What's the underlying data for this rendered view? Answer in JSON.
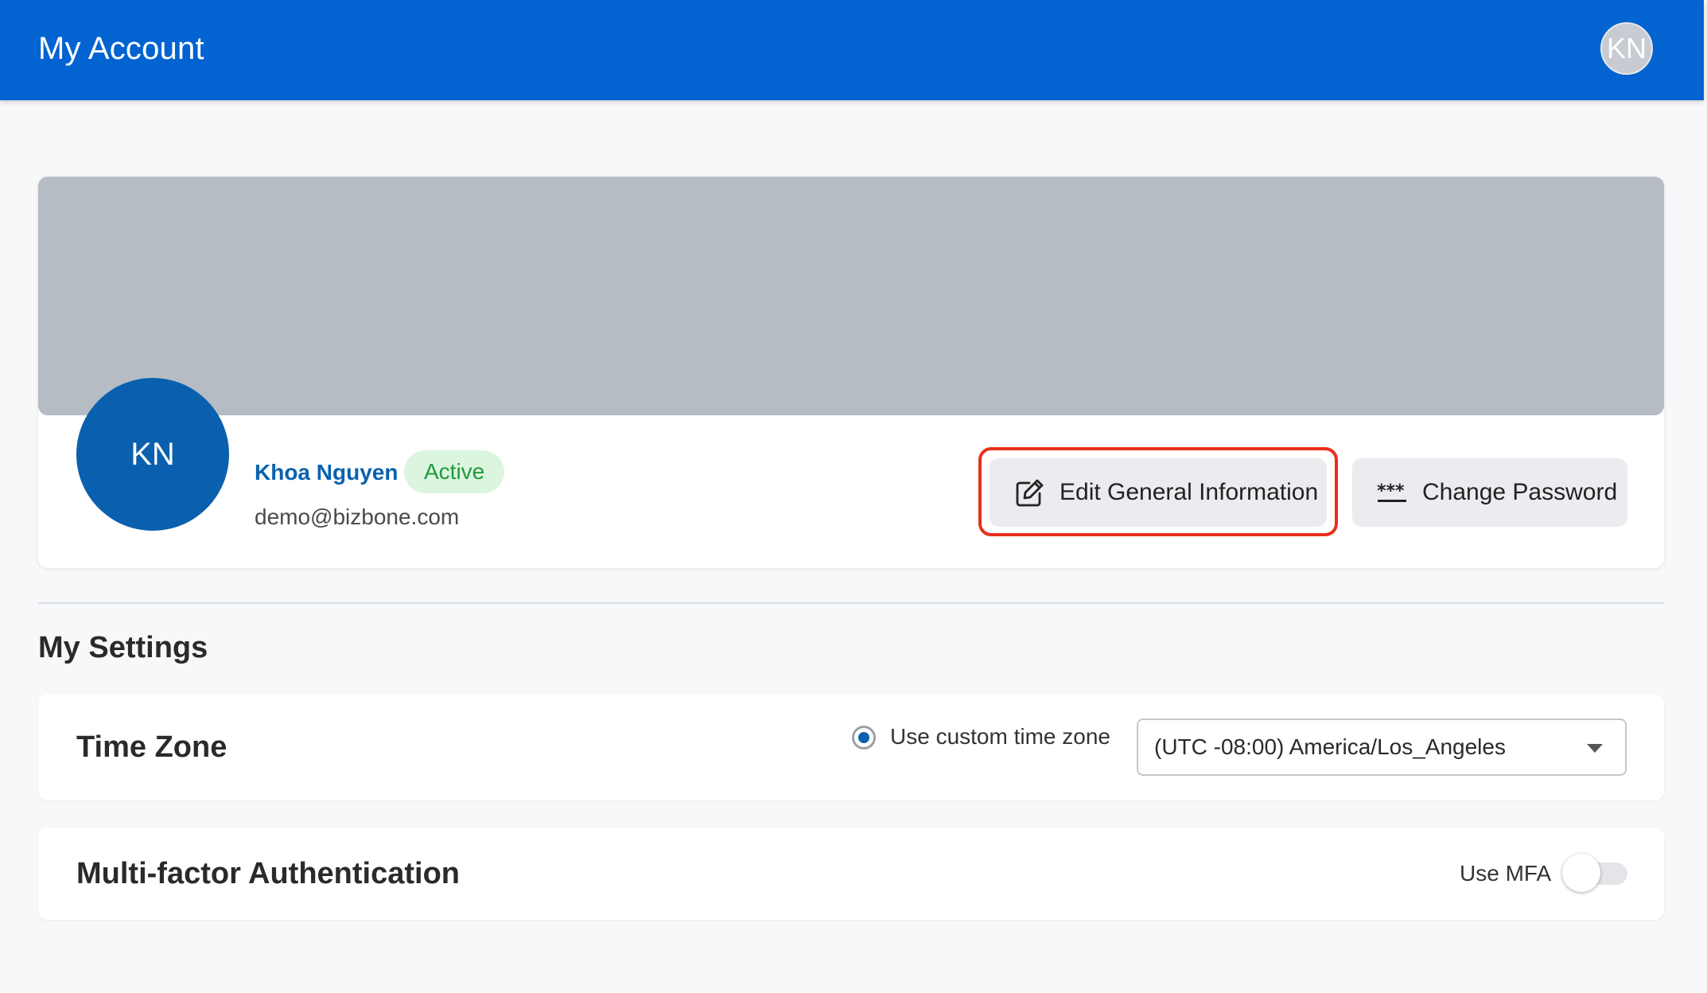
{
  "header": {
    "title": "My Account",
    "avatar_initials": "KN"
  },
  "profile": {
    "avatar_initials": "KN",
    "name": "Khoa Nguyen",
    "status": "Active",
    "email": "demo@bizbone.com",
    "edit_button_label": "Edit General Information",
    "change_password_label": "Change Password",
    "edit_icon": "edit-pencil-icon",
    "password_icon": "password-asterisks-icon"
  },
  "settings": {
    "heading": "My Settings",
    "time_zone": {
      "title": "Time Zone",
      "radio_label": "Use custom time zone",
      "radio_selected": true,
      "selected_value": "(UTC -08:00) America/Los_Angeles"
    },
    "mfa": {
      "title": "Multi-factor Authentication",
      "toggle_label": "Use MFA",
      "enabled": false
    }
  },
  "colors": {
    "header_bg": "#0263d1",
    "avatar_bg": "#0a60ae",
    "cover_bg": "#b6bcc4",
    "status_bg": "#dcf5df",
    "status_text": "#1f9a3c",
    "highlight": "#e8301c"
  }
}
